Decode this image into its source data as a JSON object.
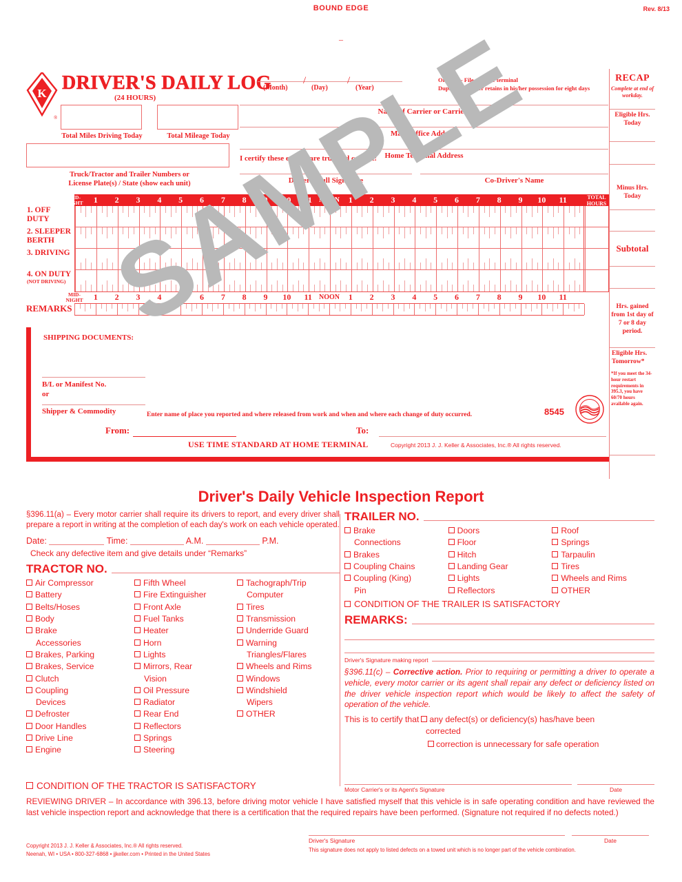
{
  "header": {
    "bound_edge": "BOUND EDGE",
    "revision": "Rev. 8/13",
    "tick": "–"
  },
  "log": {
    "title": "DRIVER'S DAILY LOG",
    "subtitle": "(24 HOURS)",
    "date_labels": {
      "month": "(Month)",
      "day": "(Day)",
      "year": "(Year)",
      "slash": "/"
    },
    "original_note_line1": "Original - File at home terminal",
    "original_note_line2": "Duplicate - Driver retains in his/her possession for eight days",
    "total_miles_caption": "Total Miles Driving Today",
    "total_mileage_caption": "Total Mileage Today",
    "truck_caption_line1": "Truck/Tractor and Trailer Numbers or",
    "truck_caption_line2": "License Plate(s) / State (show each unit)",
    "carrier_label": "Name of Carrier or Carriers",
    "office_label": "Main Office Address",
    "home_terminal_label": "Home Terminal Address",
    "certify_text": "I certify these entries are true and correct:",
    "driver_signature_label": "Driver's Full Signature",
    "co_driver_label": "Co-Driver's Name"
  },
  "recap": {
    "heading": "RECAP",
    "subheading": "Complete at end of workday.",
    "eligible_today": "Eligible Hrs. Today",
    "minus_today": "Minus Hrs. Today",
    "subtotal": "Subtotal",
    "hrs_gained": "Hrs. gained from 1st day of 7 or 8 day period.",
    "eligible_tomorrow": "Eligible Hrs. Tomorrow*",
    "footnote": "*If you meet the 34-hour restart requirements in 395.3, you have 60/70 hours available again."
  },
  "grid": {
    "midnight_label": "MID-NIGHT",
    "noon_label": "NOON",
    "total_hours_label": "TOTAL HOURS",
    "hours_am": [
      "1",
      "2",
      "3",
      "4",
      "5",
      "6",
      "7",
      "8",
      "9",
      "10",
      "11"
    ],
    "hours_pm": [
      "1",
      "2",
      "3",
      "4",
      "5",
      "6",
      "7",
      "8",
      "9",
      "10",
      "11"
    ],
    "status_rows": [
      {
        "number": "1.",
        "label": "OFF DUTY",
        "sub": ""
      },
      {
        "number": "2.",
        "label": "SLEEPER BERTH",
        "sub": ""
      },
      {
        "number": "3.",
        "label": "DRIVING",
        "sub": ""
      },
      {
        "number": "4.",
        "label": "ON DUTY",
        "sub": "(NOT DRIVING)"
      }
    ],
    "remarks_label": "REMARKS"
  },
  "remarks_box": {
    "shipping_documents": "SHIPPING DOCUMENTS:",
    "bl_label_line1": "B/L or Manifest No.",
    "bl_label_line2": "or",
    "shipper_label": "Shipper & Commodity",
    "from_label": "From:",
    "to_label": "To:",
    "enter_note": "Enter name of place you reported and where released from work and when and where each change of duty occurred.",
    "use_time": "USE TIME STANDARD AT HOME TERMINAL",
    "copyright": "Copyright 2013 J. J. Keller & Associates, Inc.® All rights reserved.",
    "form_number": "8545",
    "seal_name": "flag-seal"
  },
  "dvir": {
    "title": "Driver's Daily Vehicle Inspection Report",
    "regulation_a": "§396.11(a) – Every motor carrier shall require its drivers to report, and every driver shall prepare a report in writing at the completion of each day's work on each vehicle operated.",
    "date_label": "Date:",
    "time_label": "Time:",
    "am_label": "A.M.",
    "pm_label": "P.M.",
    "check_note": "Check any defective item and give details under “Remarks”",
    "tractor_heading": "TRACTOR NO.",
    "tractor_col1": [
      {
        "text": "Air Compressor",
        "box": true
      },
      {
        "text": "Battery",
        "box": true
      },
      {
        "text": "Belts/Hoses",
        "box": true
      },
      {
        "text": "Body",
        "box": true
      },
      {
        "text": "Brake",
        "box": true
      },
      {
        "text": "Accessories",
        "box": false
      },
      {
        "text": "Brakes, Parking",
        "box": true
      },
      {
        "text": "Brakes, Service",
        "box": true
      },
      {
        "text": "Clutch",
        "box": true
      },
      {
        "text": "Coupling",
        "box": true
      },
      {
        "text": "Devices",
        "box": false
      },
      {
        "text": "Defroster",
        "box": true
      },
      {
        "text": "Door Handles",
        "box": true
      },
      {
        "text": "Drive Line",
        "box": true
      },
      {
        "text": "Engine",
        "box": true
      }
    ],
    "tractor_col2": [
      {
        "text": "Fifth Wheel",
        "box": true
      },
      {
        "text": "Fire Extinguisher",
        "box": true
      },
      {
        "text": "Front Axle",
        "box": true
      },
      {
        "text": "Fuel Tanks",
        "box": true
      },
      {
        "text": "Heater",
        "box": true
      },
      {
        "text": "Horn",
        "box": true
      },
      {
        "text": "Lights",
        "box": true
      },
      {
        "text": "Mirrors, Rear",
        "box": true
      },
      {
        "text": "Vision",
        "box": false
      },
      {
        "text": "Oil Pressure",
        "box": true
      },
      {
        "text": "Radiator",
        "box": true
      },
      {
        "text": "Rear End",
        "box": true
      },
      {
        "text": "Reflectors",
        "box": true
      },
      {
        "text": "Springs",
        "box": true
      },
      {
        "text": "Steering",
        "box": true
      }
    ],
    "tractor_col3": [
      {
        "text": "Tachograph/Trip",
        "box": true
      },
      {
        "text": "Computer",
        "box": false
      },
      {
        "text": "Tires",
        "box": true
      },
      {
        "text": "Transmission",
        "box": true
      },
      {
        "text": "Underride Guard",
        "box": true
      },
      {
        "text": "Warning",
        "box": true
      },
      {
        "text": "Triangles/Flares",
        "box": false
      },
      {
        "text": "Wheels and Rims",
        "box": true
      },
      {
        "text": "Windows",
        "box": true
      },
      {
        "text": "Windshield",
        "box": true
      },
      {
        "text": "Wipers",
        "box": false
      },
      {
        "text": "OTHER",
        "box": true
      }
    ],
    "tractor_satisfactory": "CONDITION OF THE TRACTOR IS SATISFACTORY",
    "trailer_heading": "TRAILER NO.",
    "trailer_col1": [
      {
        "text": "Brake",
        "box": true
      },
      {
        "text": "Connections",
        "box": false
      },
      {
        "text": "Brakes",
        "box": true
      },
      {
        "text": "Coupling Chains",
        "box": true
      },
      {
        "text": "Coupling (King)",
        "box": true
      },
      {
        "text": "Pin",
        "box": false
      }
    ],
    "trailer_col2": [
      {
        "text": "Doors",
        "box": true
      },
      {
        "text": "Floor",
        "box": true
      },
      {
        "text": "Hitch",
        "box": true
      },
      {
        "text": "Landing Gear",
        "box": true
      },
      {
        "text": "Lights",
        "box": true
      },
      {
        "text": "Reflectors",
        "box": true
      }
    ],
    "trailer_col3": [
      {
        "text": "Roof",
        "box": true
      },
      {
        "text": "Springs",
        "box": true
      },
      {
        "text": "Tarpaulin",
        "box": true
      },
      {
        "text": "Tires",
        "box": true
      },
      {
        "text": "Wheels and Rims",
        "box": true
      },
      {
        "text": "OTHER",
        "box": true
      }
    ],
    "trailer_satisfactory": "CONDITION OF THE TRAILER IS SATISFACTORY",
    "remarks_heading": "REMARKS:",
    "driver_sig_making_report": "Driver's Signature making report",
    "corrective_prefix": "§396.11(c) – ",
    "corrective_bold": "Corrective action.",
    "corrective_text": " Prior to requiring or permitting a driver to operate a vehicle, every motor carrier or its agent shall repair any defect or deficiency listed on the driver vehicle inspection report which would be likely to affect the safety of operation of the vehicle.",
    "certify_prefix": "This is to certify that",
    "certify_option1": "any defect(s) or deficiency(s) has/have been",
    "certify_option1_cont": "corrected",
    "certify_option2": "correction is unnecessary for safe operation",
    "motor_carrier_sig": "Motor Carrier's or its Agent's Signature",
    "date_col_label": "Date"
  },
  "footer": {
    "reviewing_driver": "REVIEWING DRIVER – In accordance with 396.13, before driving motor vehicle I have satisfied myself that this vehicle is in safe operating condition and have reviewed the last vehicle inspection report and acknowledge that there is a certification that the required repairs have been performed. (Signature not required if no defects noted.)",
    "copyright_line1": "Copyright 2013 J. J. Keller & Associates, Inc.® All rights reserved.",
    "copyright_line2": "Neenah, WI • USA • 800-327-6868 • jjkeller.com • Printed in the United States",
    "driver_signature_label": "Driver's Signature",
    "date_label": "Date",
    "signature_note": "This signature does not apply to listed defects on a towed unit which is no longer part of the vehicle combination."
  },
  "watermark": {
    "text": "SAMPLE"
  },
  "colors": {
    "brand_red": "#ED2024",
    "light_red": "#EE6B6B",
    "rule": "#E8908F",
    "watermark_gray": "#B9B9B9"
  }
}
